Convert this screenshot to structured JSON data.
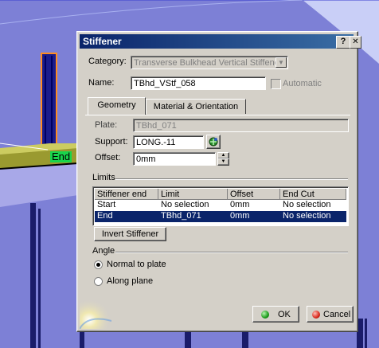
{
  "viewport": {
    "end_label": "End"
  },
  "dialog": {
    "title": "Stiffener",
    "help_button": "?",
    "close_button": "X",
    "category_label": "Category:",
    "category_value": "Transverse Bulkhead Vertical Stiffene",
    "name_label": "Name:",
    "name_value": "TBhd_VStf_058",
    "automatic_label": "Automatic",
    "tabs": [
      {
        "label": "Geometry",
        "active": true
      },
      {
        "label": "Material & Orientation",
        "active": false
      }
    ],
    "plate_label": "Plate:",
    "plate_value": "TBhd_071",
    "support_label": "Support:",
    "support_value": "LONG.-11",
    "offset_label": "Offset:",
    "offset_value": "0mm",
    "limits_label": "Limits",
    "limits_table": {
      "headers": [
        "Stiffener end",
        "Limit",
        "Offset",
        "End Cut"
      ],
      "rows": [
        [
          "Start",
          "No selection",
          "0mm",
          "No selection"
        ],
        [
          "End",
          "TBhd_071",
          "0mm",
          "No selection"
        ]
      ],
      "selected_row": 1
    },
    "invert_button": "Invert Stiffener",
    "angle_label": "Angle",
    "angle_options": [
      {
        "label": "Normal to plate",
        "selected": true
      },
      {
        "label": "Along plane",
        "selected": false
      }
    ],
    "ok_label": "OK",
    "cancel_label": "Cancel"
  },
  "colors": {
    "viewport_bg": "#7d80d6",
    "titlebar": "#0a246a",
    "selection": "#0a246a"
  }
}
